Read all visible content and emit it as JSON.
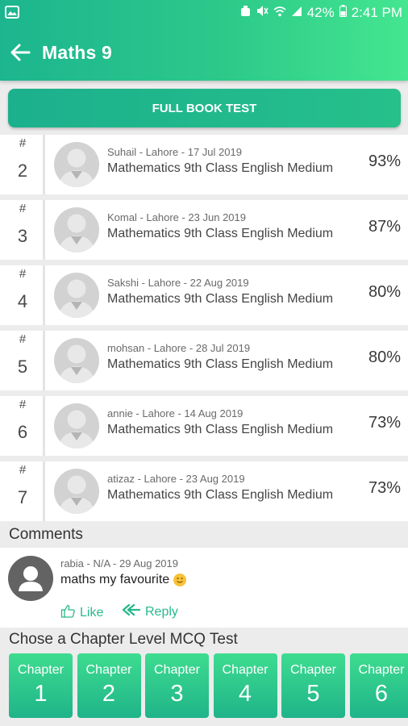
{
  "status_bar": {
    "battery": "42%",
    "time": "2:41 PM"
  },
  "app_bar": {
    "title": "Maths 9"
  },
  "full_book_button": {
    "label": "FULL BOOK TEST"
  },
  "leaderboard": {
    "hash": "#",
    "items": [
      {
        "rank": "2",
        "meta": "Suhail - Lahore - 17 Jul 2019",
        "subject": "Mathematics 9th Class English Medium",
        "score": "93%"
      },
      {
        "rank": "3",
        "meta": "Komal - Lahore - 23 Jun 2019",
        "subject": "Mathematics 9th Class English Medium",
        "score": "87%"
      },
      {
        "rank": "4",
        "meta": "Sakshi - Lahore - 22 Aug 2019",
        "subject": "Mathematics 9th Class English Medium",
        "score": "80%"
      },
      {
        "rank": "5",
        "meta": "mohsan - Lahore - 28 Jul 2019",
        "subject": "Mathematics 9th Class English Medium",
        "score": "80%"
      },
      {
        "rank": "6",
        "meta": "annie - Lahore - 14 Aug 2019",
        "subject": "Mathematics 9th Class English Medium",
        "score": "73%"
      },
      {
        "rank": "7",
        "meta": "atizaz - Lahore - 23 Aug 2019",
        "subject": "Mathematics 9th Class English Medium",
        "score": "73%"
      }
    ]
  },
  "comments": {
    "heading": "Comments",
    "items": [
      {
        "meta": "rabia - N/A - 29 Aug 2019",
        "text": "maths my favourite",
        "emoji": "smiling-face-icon",
        "like_label": "Like",
        "reply_label": "Reply"
      }
    ]
  },
  "chapters": {
    "heading": "Chose a Chapter Level MCQ Test",
    "items": [
      {
        "label": "Chapter",
        "number": "1"
      },
      {
        "label": "Chapter",
        "number": "2"
      },
      {
        "label": "Chapter",
        "number": "3"
      },
      {
        "label": "Chapter",
        "number": "4"
      },
      {
        "label": "Chapter",
        "number": "5"
      },
      {
        "label": "Chapter",
        "number": "6"
      }
    ]
  },
  "colors": {
    "brand_green": "#1cb58f",
    "accent_green": "#44e690",
    "link_green": "#28b98c"
  }
}
